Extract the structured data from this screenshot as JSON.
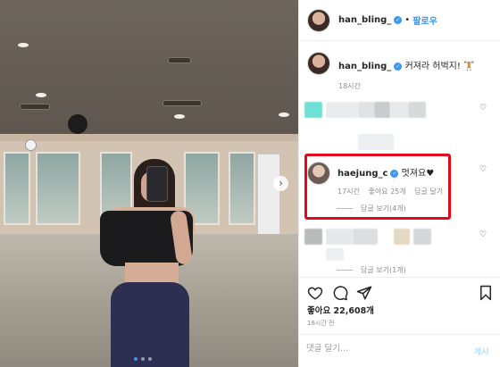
{
  "post": {
    "username": "han_bling_",
    "follow_label": "팔로우",
    "separator": "•",
    "caption_text": "커져라 허벅지! 🏋",
    "caption_time": "18시간"
  },
  "highlighted_comment": {
    "username": "haejung_c",
    "text": "멋져요♥",
    "time": "17시간",
    "likes": "좋아요 25개",
    "reply_label": "답글 달기",
    "view_replies": "답글 보기(4개)"
  },
  "second_thread": {
    "view_replies": "답글 보기(1개)"
  },
  "footer": {
    "likes": "좋아요 22,608개",
    "time_ago": "18시간 전",
    "comment_placeholder": "댓글 달기...",
    "post_label": "게시"
  },
  "colors": {
    "accent": "#3897f0",
    "highlight_border": "#e2091c"
  },
  "icons": [
    "heart-icon",
    "comment-icon",
    "share-icon",
    "bookmark-icon",
    "verified-icon",
    "chevron-right-icon"
  ]
}
